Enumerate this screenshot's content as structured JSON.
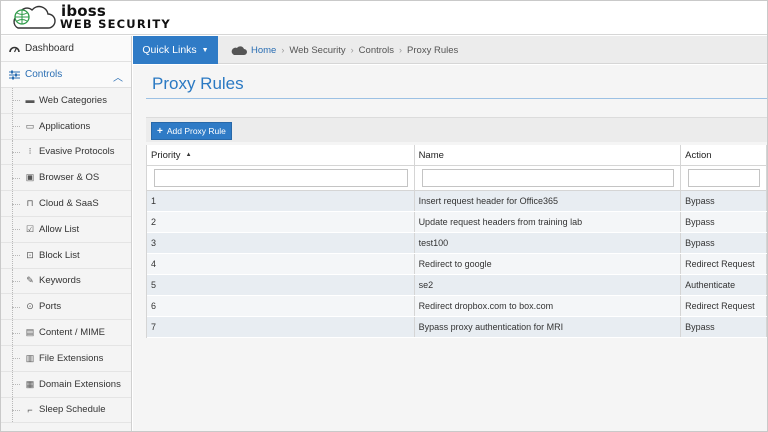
{
  "brand": {
    "line1": "iboss",
    "line2": "WEB SECURITY"
  },
  "sidebar": {
    "dashboard": "Dashboard",
    "controls": "Controls",
    "items": [
      {
        "label": "Web Categories",
        "icon": "folder-icon"
      },
      {
        "label": "Applications",
        "icon": "window-icon"
      },
      {
        "label": "Evasive Protocols",
        "icon": "protocol-icon"
      },
      {
        "label": "Browser & OS",
        "icon": "browser-icon"
      },
      {
        "label": "Cloud & SaaS",
        "icon": "cloud-saas-icon"
      },
      {
        "label": "Allow List",
        "icon": "checkbox-icon"
      },
      {
        "label": "Block List",
        "icon": "block-icon"
      },
      {
        "label": "Keywords",
        "icon": "pencil-icon"
      },
      {
        "label": "Ports",
        "icon": "plug-icon"
      },
      {
        "label": "Content / MIME",
        "icon": "content-icon"
      },
      {
        "label": "File Extensions",
        "icon": "file-icon"
      },
      {
        "label": "Domain Extensions",
        "icon": "domain-icon"
      },
      {
        "label": "Sleep Schedule",
        "icon": "bed-icon"
      }
    ]
  },
  "topnav": {
    "quick_links": "Quick Links",
    "breadcrumb": [
      "Home",
      "Web Security",
      "Controls",
      "Proxy Rules"
    ]
  },
  "main": {
    "title": "Proxy Rules",
    "add_button": "Add Proxy Rule",
    "columns": [
      "Priority",
      "Name",
      "Action"
    ],
    "rows": [
      {
        "priority": "1",
        "name": "Insert request header for Office365",
        "action": "Bypass"
      },
      {
        "priority": "2",
        "name": "Update request headers from training lab",
        "action": "Bypass"
      },
      {
        "priority": "3",
        "name": "test100",
        "action": "Bypass"
      },
      {
        "priority": "4",
        "name": "Redirect to google",
        "action": "Redirect Request"
      },
      {
        "priority": "5",
        "name": "se2",
        "action": "Authenticate"
      },
      {
        "priority": "6",
        "name": "Redirect dropbox.com to box.com",
        "action": "Redirect Request"
      },
      {
        "priority": "7",
        "name": "Bypass proxy authentication for MRI",
        "action": "Bypass"
      }
    ]
  },
  "colors": {
    "accent": "#2f7bc6",
    "title": "#2a79c3",
    "sidebar_bg": "#f4f4f4"
  }
}
